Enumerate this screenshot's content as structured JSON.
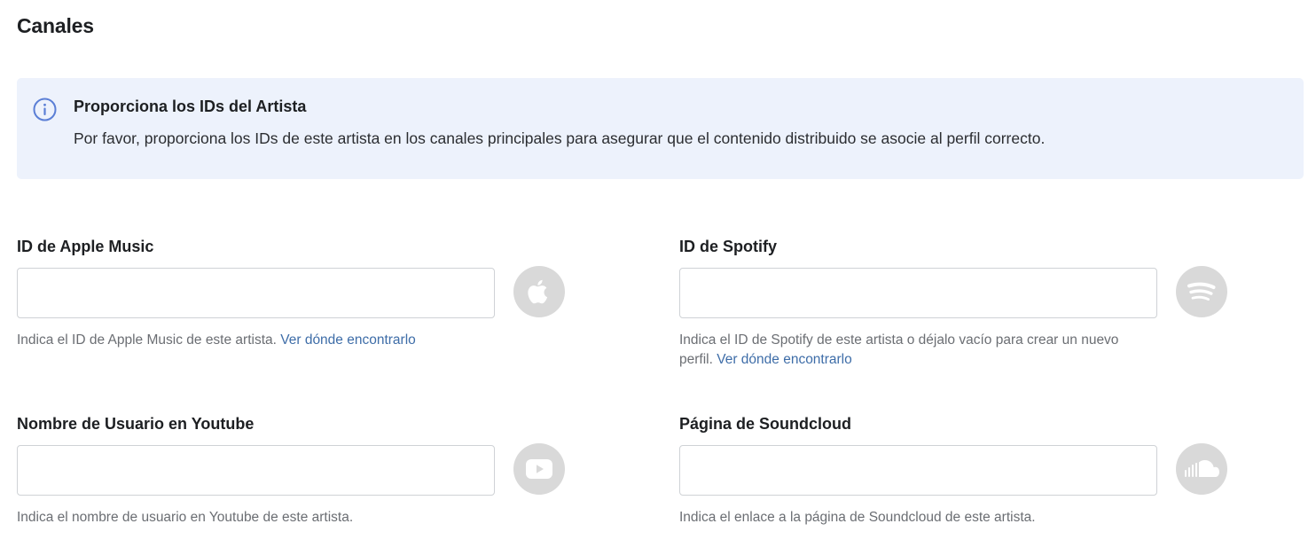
{
  "page": {
    "title": "Canales"
  },
  "banner": {
    "title": "Proporciona los IDs del Artista",
    "text": "Por favor, proporciona los IDs de este artista en los canales principales para asegurar que el contenido distribuido se asocie al perfil correcto."
  },
  "fields": {
    "apple": {
      "label": "ID de Apple Music",
      "value": "",
      "placeholder": "",
      "help": "Indica el ID de Apple Music de este artista. ",
      "link": "Ver dónde encontrarlo",
      "icon": "apple-icon"
    },
    "spotify": {
      "label": "ID de Spotify",
      "value": "",
      "placeholder": "",
      "help": "Indica el ID de Spotify de este artista o déjalo vacío para crear un nuevo perfil. ",
      "link": "Ver dónde encontrarlo",
      "icon": "spotify-icon"
    },
    "youtube": {
      "label": "Nombre de Usuario en Youtube",
      "value": "",
      "placeholder": "",
      "help": "Indica el nombre de usuario en Youtube de este artista.",
      "icon": "youtube-icon"
    },
    "soundcloud": {
      "label": "Página de Soundcloud",
      "value": "",
      "placeholder": "",
      "help": "Indica el enlace a la página de Soundcloud de este artista.",
      "icon": "soundcloud-icon"
    }
  },
  "colors": {
    "banner_bg": "#edf2fc",
    "info_icon": "#5b7fd6",
    "link": "#3e6da8",
    "brand_icon_bg": "#d9d9d9"
  }
}
